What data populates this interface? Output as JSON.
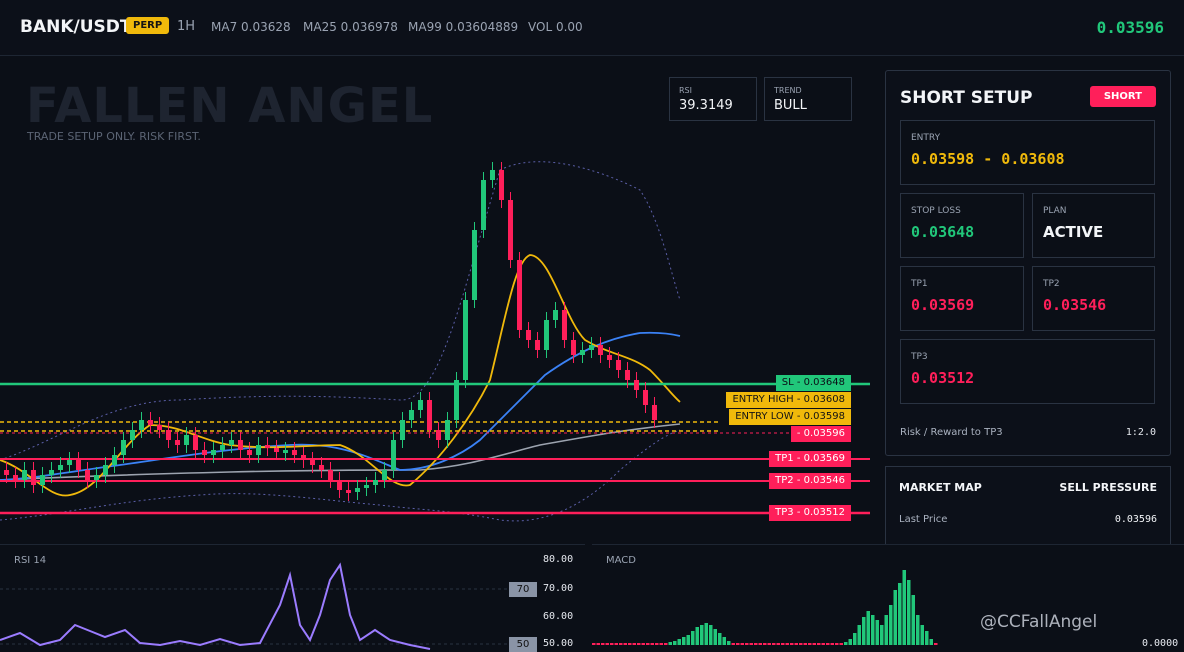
{
  "header": {
    "pair": "BANK/USDT",
    "badge": "PERP",
    "timeframe": "1H",
    "ma7": "MA7 0.03628",
    "ma25": "MA25 0.036978",
    "ma99": "MA99 0.03604889",
    "vol": "VOL 0.00",
    "last_price": "0.03596"
  },
  "watermark": {
    "title": "FALLEN ANGEL",
    "subtitle": "TRADE SETUP ONLY. RISK FIRST."
  },
  "indicators": {
    "rsi_label": "RSI",
    "rsi_value": "39.3149",
    "trend_label": "TREND",
    "trend_value": "BULL"
  },
  "price_tags": {
    "sl": "SL  -  0.03648",
    "entry_high": "ENTRY HIGH  -  0.03608",
    "entry_low": "ENTRY LOW  -  0.03598",
    "current": "-  0.03596",
    "tp1": "TP1  -  0.03569",
    "tp2": "TP2  -  0.03546",
    "tp3": "TP3  -  0.03512"
  },
  "setup": {
    "title": "SHORT SETUP",
    "side": "SHORT",
    "entry_label": "ENTRY",
    "entry_value": "0.03598 - 0.03608",
    "sl_label": "STOP LOSS",
    "sl_value": "0.03648",
    "plan_label": "PLAN",
    "plan_value": "ACTIVE",
    "tp1_label": "TP1",
    "tp1_value": "0.03569",
    "tp2_label": "TP2",
    "tp2_value": "0.03546",
    "tp3_label": "TP3",
    "tp3_value": "0.03512",
    "rr_label": "Risk / Reward to TP3",
    "rr_value": "1:2.0"
  },
  "market": {
    "title": "MARKET MAP",
    "pressure": "SELL PRESSURE",
    "last_label": "Last Price",
    "last_value": "0.03596"
  },
  "rsi_pane": {
    "label": "RSI 14",
    "ticks": [
      "80.00",
      "70.00",
      "60.00",
      "50.00"
    ],
    "tag70": "70",
    "tag50": "50"
  },
  "macd_pane": {
    "label": "MACD",
    "zero": "0.0000"
  },
  "brand": "@CCFallAngel",
  "colors": {
    "up": "#21c77a",
    "down": "#ff1f5a",
    "entry": "#f0b90b",
    "ma7": "#f0b90b",
    "ma25": "#3b82f6",
    "ma99": "#9ca3af",
    "rsi": "#9b7cff"
  }
}
